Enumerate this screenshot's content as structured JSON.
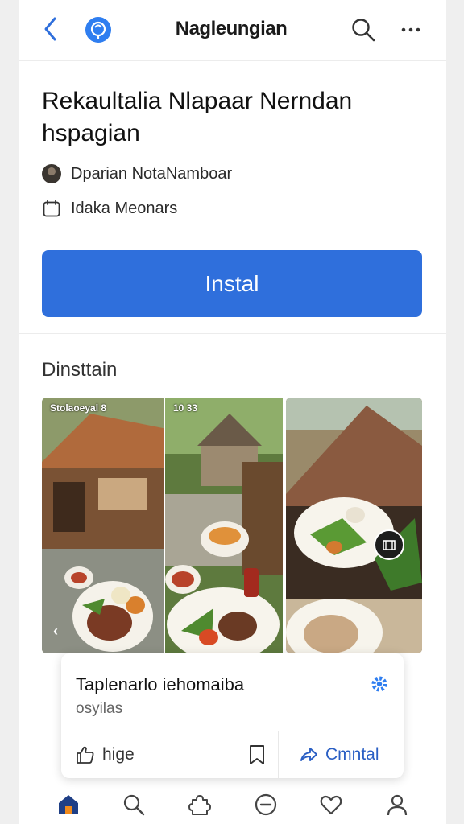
{
  "header": {
    "title": "Nagleungian",
    "back_icon": "chevron-left-icon",
    "logo_icon": "app-logo-icon",
    "search_icon": "search-icon",
    "more_icon": "more-horizontal-icon"
  },
  "app": {
    "name": "Rekaultalia Nlapaar Nerndan hspagian",
    "developer": "Dparian NotaNamboar",
    "category": "Idaka Meonars",
    "install_label": "Instal"
  },
  "gallery": {
    "section_title": "Dinsttain",
    "shots": [
      {
        "status_text": "Stolaoeyal 8"
      },
      {
        "status_text": "10 33"
      },
      {
        "status_text": ""
      }
    ]
  },
  "card": {
    "title": "Taplenarlo iehomaiba",
    "subtitle": "osyilas",
    "like_label": "hige",
    "comment_label": "Cmntal"
  },
  "bottom_nav": {
    "items": [
      {
        "icon": "home-icon",
        "active": true
      },
      {
        "icon": "search-icon"
      },
      {
        "icon": "puzzle-icon"
      },
      {
        "icon": "minus-circle-icon"
      },
      {
        "icon": "heart-icon"
      },
      {
        "icon": "profile-icon"
      }
    ]
  },
  "colors": {
    "accent": "#2f6fdc",
    "link": "#2a5fc4",
    "logo": "#2f7ef0"
  }
}
